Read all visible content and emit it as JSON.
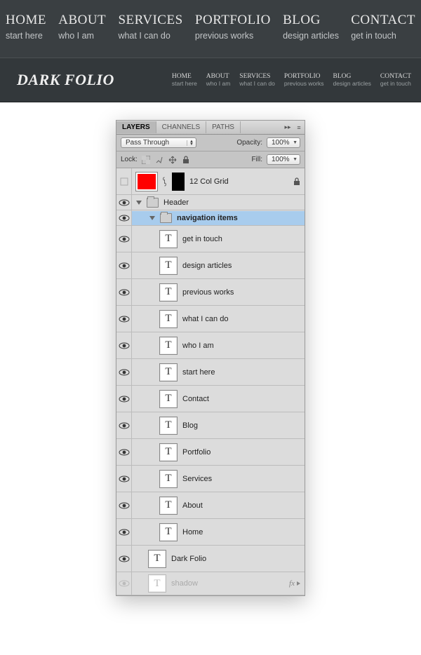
{
  "nav": {
    "items": [
      {
        "label": "HOME",
        "sub": "start here"
      },
      {
        "label": "ABOUT",
        "sub": "who I am"
      },
      {
        "label": "SERVICES",
        "sub": "what I can do"
      },
      {
        "label": "PORTFOLIO",
        "sub": "previous works"
      },
      {
        "label": "BLOG",
        "sub": "design articles"
      },
      {
        "label": "CONTACT",
        "sub": "get in touch"
      }
    ]
  },
  "logo": "DARK FOLIO",
  "mini_nav": {
    "items": [
      {
        "label": "HOME",
        "sub": "start here"
      },
      {
        "label": "ABOUT",
        "sub": "who I am"
      },
      {
        "label": "SERVICES",
        "sub": "what I can do"
      },
      {
        "label": "PORTFOLIO",
        "sub": "previous works"
      },
      {
        "label": "BLOG",
        "sub": "design articles"
      },
      {
        "label": "CONTACT",
        "sub": "get in touch"
      }
    ]
  },
  "panel": {
    "tabs": {
      "layers": "LAYERS",
      "channels": "CHANNELS",
      "paths": "PATHS"
    },
    "blend_mode": "Pass Through",
    "opacity_label": "Opacity:",
    "opacity_value": "100%",
    "lock_label": "Lock:",
    "fill_label": "Fill:",
    "fill_value": "100%",
    "fx_label": "fx"
  },
  "layers": {
    "grid_name": "12 Col Grid",
    "header_group": "Header",
    "nav_group": "navigation items",
    "text_layers": [
      "get in touch",
      "design articles",
      "previous works",
      "what I can do",
      "who I am",
      "start here",
      "Contact",
      "Blog",
      "Portfolio",
      "Services",
      "About",
      "Home"
    ],
    "dark_folio": "Dark Folio",
    "shadow": "shadow"
  }
}
